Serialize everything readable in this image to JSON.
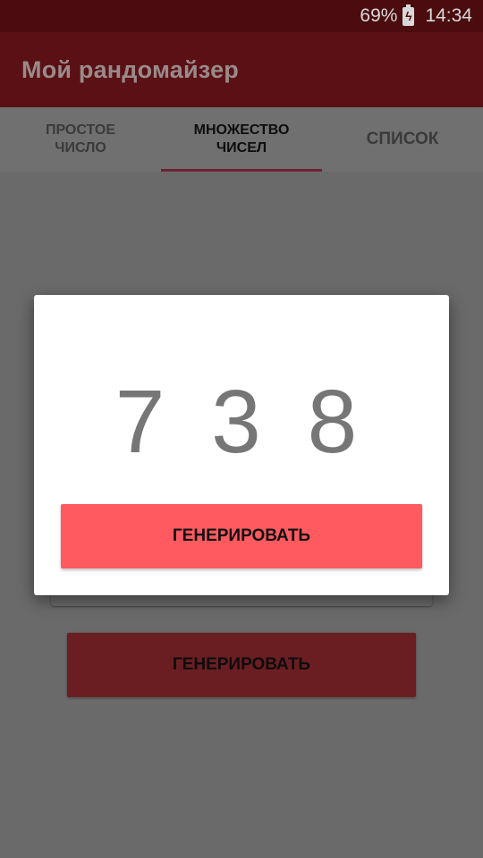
{
  "status_bar": {
    "battery_percent": "69%",
    "time": "14:34",
    "battery_icon": "battery-charging-icon"
  },
  "app_bar": {
    "title": "Мой рандомайзер"
  },
  "tabs": [
    {
      "label": "ПРОСТОЕ\nЧИСЛО",
      "active": false
    },
    {
      "label": "МНОЖЕСТВО\nЧИСЕЛ",
      "active": true
    },
    {
      "label": "СПИСОК",
      "active": false
    }
  ],
  "main": {
    "generate_label": "ГЕНЕРИРОВАТЬ"
  },
  "dialog": {
    "result": "7 3 8",
    "generate_label": "ГЕНЕРИРОВАТЬ"
  },
  "colors": {
    "status_bar": "#4a0c0e",
    "app_bar": "#5a1014",
    "tab_indicator": "#6e2234",
    "dialog_button": "#ff5a5f",
    "background_button": "#6b1e22"
  }
}
